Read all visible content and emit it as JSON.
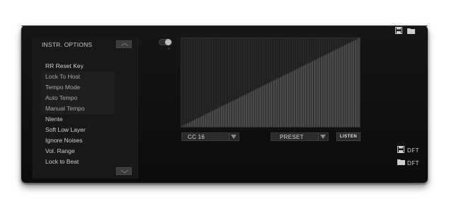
{
  "options_panel": {
    "title": "INSTR. OPTIONS",
    "items": [
      {
        "label": "RR Reset Key",
        "shaded": false
      },
      {
        "label": "Lock To Host",
        "shaded": true
      },
      {
        "label": "Tempo Mode",
        "shaded": true
      },
      {
        "label": "Auto Tempo",
        "shaded": true
      },
      {
        "label": "Manual Tempo",
        "shaded": true
      },
      {
        "label": "Niente",
        "shaded": false
      },
      {
        "label": "Soft Low Layer",
        "shaded": false
      },
      {
        "label": "Ignore Noises",
        "shaded": false
      },
      {
        "label": "Vol. Range",
        "shaded": false
      },
      {
        "label": "Lock to Beat",
        "shaded": false
      }
    ]
  },
  "toggle": {
    "state": "on"
  },
  "graph": {
    "fill_color": "#5a5a5a",
    "line_count": 100,
    "shape": "linear-ramp"
  },
  "selectors": {
    "cc": {
      "value": "CC 16"
    },
    "preset": {
      "value": "PRESET"
    },
    "listen_label": "LISTEN"
  },
  "right_icons": {
    "dft_save_label": "DFT",
    "dft_load_label": "DFT"
  },
  "colors": {
    "panel": "#111111",
    "accent_text": "#cfcfcf"
  }
}
